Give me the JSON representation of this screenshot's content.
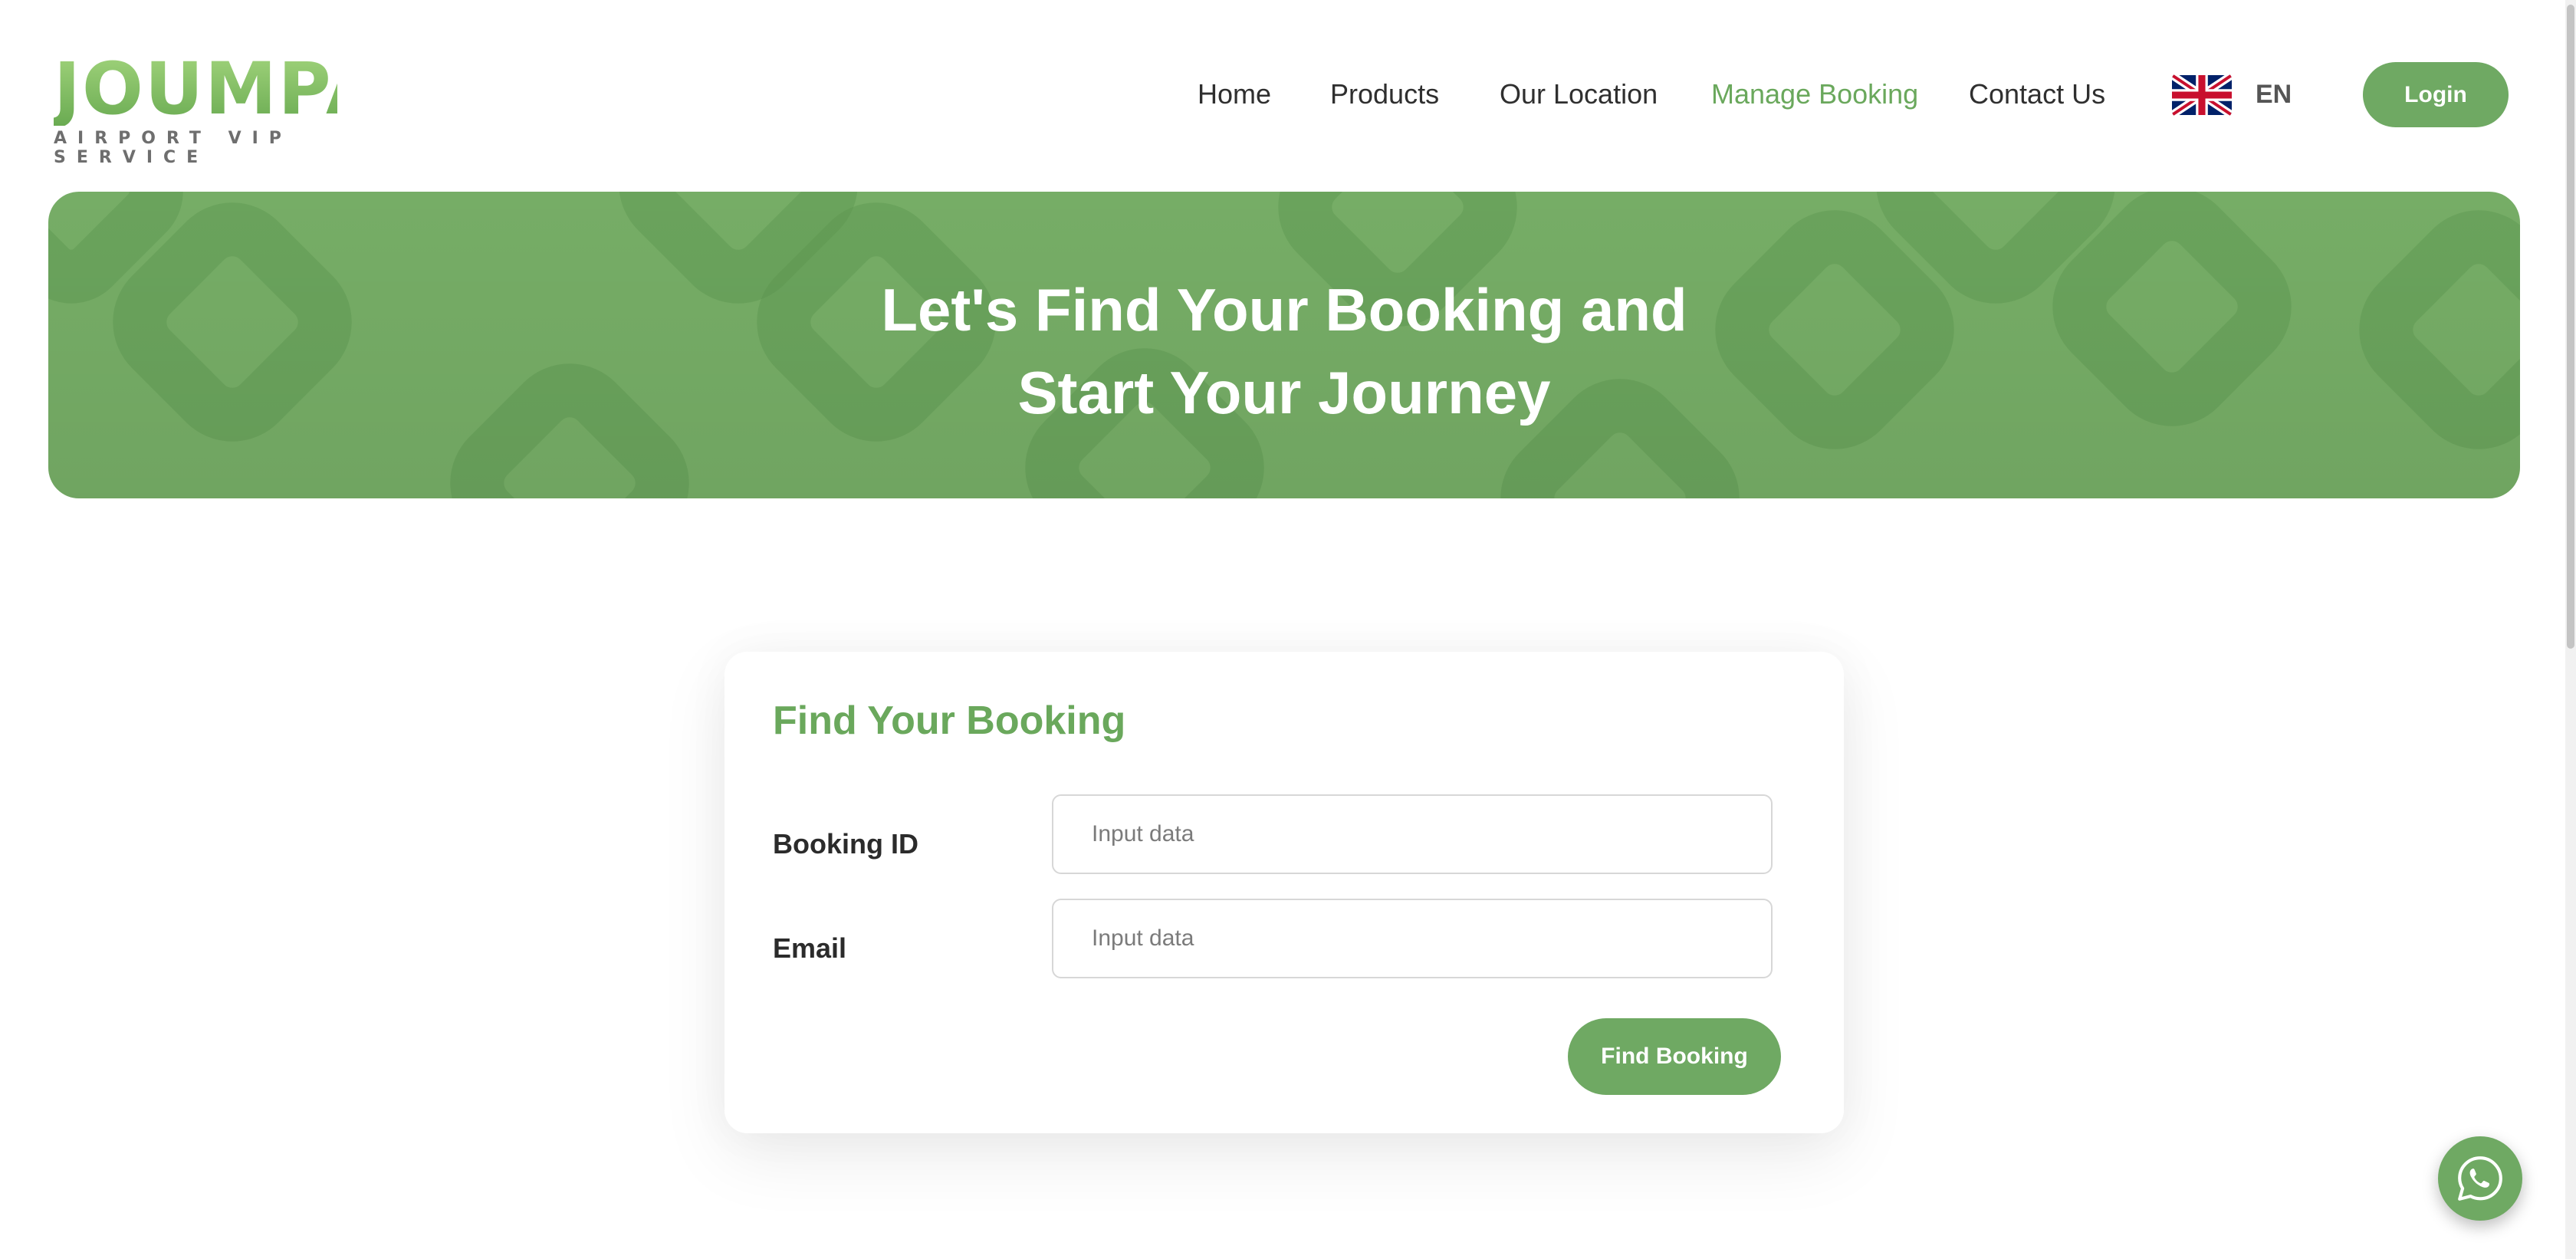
{
  "header": {
    "logo": {
      "text": "JOUMPA",
      "tagline": "AIRPORT VIP SERVICE"
    },
    "nav": [
      {
        "label": "Home"
      },
      {
        "label": "Products"
      },
      {
        "label": "Our Location"
      },
      {
        "label": "Manage Booking",
        "active": true
      },
      {
        "label": "Contact Us"
      }
    ],
    "language": {
      "flag_icon": "uk-flag-icon",
      "code": "EN"
    },
    "login_label": "Login"
  },
  "hero": {
    "title_line1": "Let's Find Your Booking and",
    "title_line2": "Start Your Journey"
  },
  "form": {
    "title": "Find Your Booking",
    "booking_id": {
      "label": "Booking ID",
      "placeholder": "Input data",
      "value": ""
    },
    "email": {
      "label": "Email",
      "placeholder": "Input data",
      "value": ""
    },
    "submit_label": "Find Booking"
  },
  "floating": {
    "icon": "whatsapp-icon"
  },
  "colors": {
    "brand_green": "#6fa963",
    "active_nav": "#6aa85c",
    "hero_bg": "#76ad66"
  }
}
